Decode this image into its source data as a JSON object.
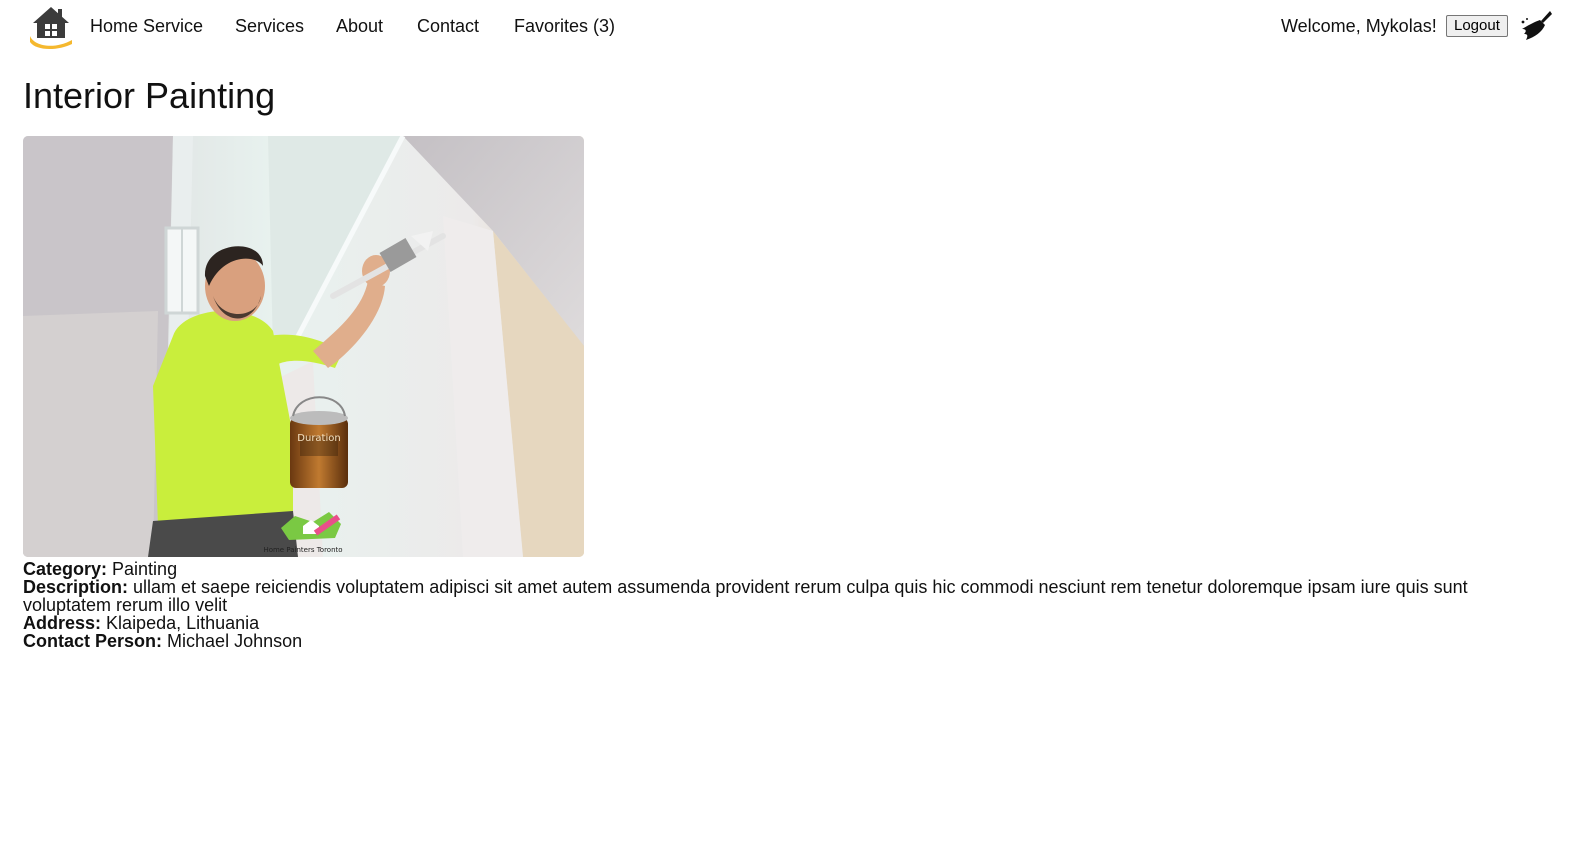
{
  "header": {
    "brand": "Home Service",
    "nav": [
      {
        "label": "Services"
      },
      {
        "label": "About"
      },
      {
        "label": "Contact"
      },
      {
        "label": "Favorites (3)"
      }
    ],
    "welcome": "Welcome, Mykolas!",
    "logout_label": "Logout",
    "logo_icon": "house-hand-logo-icon",
    "broom_icon": "broom-icon"
  },
  "page": {
    "title": "Interior Painting",
    "image_watermark": "Home Painters Toronto",
    "image_can_label": "Duration",
    "details": {
      "category_label": "Category:",
      "category": "Painting",
      "description_label": "Description:",
      "description": "ullam et saepe reiciendis voluptatem adipisci sit amet autem assumenda provident rerum culpa quis hic commodi nesciunt rem tenetur doloremque ipsam iure quis sunt voluptatem rerum illo velit",
      "address_label": "Address:",
      "address": "Klaipeda, Lithuania",
      "contact_label": "Contact Person:",
      "contact": "Michael Johnson"
    }
  },
  "colors": {
    "logo_house": "#3b3b3b",
    "logo_hand": "#f5b82e",
    "shirt": "#c9ee3c",
    "wall": "#e4ecea"
  }
}
